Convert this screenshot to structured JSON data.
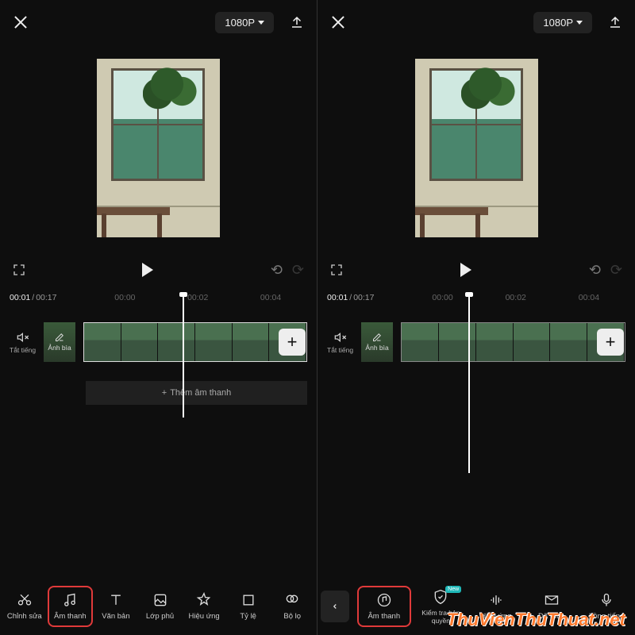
{
  "resolution": "1080P",
  "time": {
    "current": "00:01",
    "total": "00:17",
    "ticks": [
      "00:00",
      "00:02",
      "00:04"
    ]
  },
  "mute_label": "Tắt tiếng",
  "cover_label": "Ảnh bìa",
  "add_audio": "Thêm âm thanh",
  "watermark": "ThuVienThuThuat.net",
  "left_tools": [
    {
      "label": "Chỉnh sửa"
    },
    {
      "label": "Âm thanh"
    },
    {
      "label": "Văn bản"
    },
    {
      "label": "Lớp phủ"
    },
    {
      "label": "Hiệu ứng"
    },
    {
      "label": "Tỷ lệ"
    },
    {
      "label": "Bộ lọ"
    }
  ],
  "right_tools": [
    {
      "label": "Âm thanh"
    },
    {
      "label": "Kiểm tra bản quyền",
      "badge": "New"
    },
    {
      "label": "Hiệu ứng"
    },
    {
      "label": "Đã trích"
    },
    {
      "label": "Lồng tiếng"
    }
  ]
}
